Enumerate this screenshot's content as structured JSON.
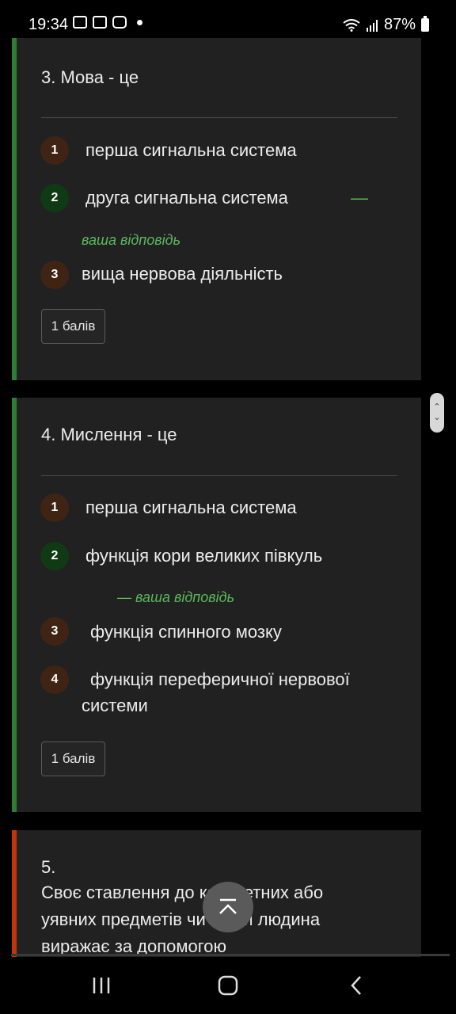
{
  "status_bar": {
    "time": "19:34",
    "battery": "87%"
  },
  "questions": [
    {
      "title": "3. Мова - це",
      "options": [
        {
          "number": "1",
          "text": "перша сигнальна система"
        },
        {
          "number": "2",
          "text": "друга сигнальна система",
          "dash": "—",
          "note": "ваша відповідь"
        },
        {
          "number": "3",
          "text": "вища нервова діяльність"
        }
      ],
      "points": "1 балів",
      "accent": "#2e7d32"
    },
    {
      "title": "4. Мислення - це",
      "options": [
        {
          "number": "1",
          "text": "перша сигнальна система"
        },
        {
          "number": "2",
          "text": "функція кори великих півкуль",
          "note": "— ваша відповідь"
        },
        {
          "number": "3",
          "text": "функція спинного мозку"
        },
        {
          "number": "4",
          "text": "функція переферичної нервової",
          "text2": "системи"
        }
      ],
      "points": "1 балів",
      "accent": "#2e7d32"
    },
    {
      "title": "5.",
      "text": "Своє ставлення до конкретних або уявних предметів чи подій людина виражає за допомогою",
      "accent": "#bf360c"
    }
  ],
  "icons": {
    "scroll_to_top": "chevron-up-icon",
    "nav_recents": "recents-icon",
    "nav_home": "home-icon",
    "nav_back": "back-icon"
  }
}
